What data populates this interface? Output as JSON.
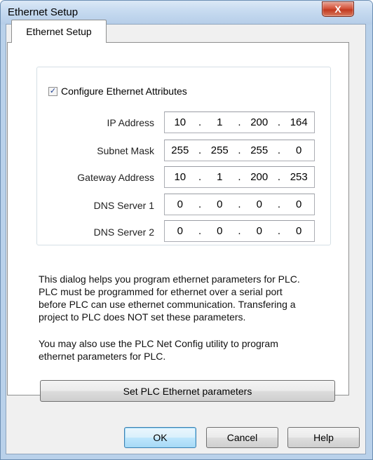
{
  "window": {
    "title": "Ethernet Setup",
    "close_glyph": "X"
  },
  "tabs": [
    {
      "label": "Ethernet Setup",
      "active": true
    }
  ],
  "group": {
    "checkbox_label": "Configure Ethernet Attributes",
    "checked": true,
    "check_glyph": "✓"
  },
  "fields": [
    {
      "label": "IP Address",
      "octets": [
        "10",
        "1",
        "200",
        "164"
      ]
    },
    {
      "label": "Subnet Mask",
      "octets": [
        "255",
        "255",
        "255",
        "0"
      ]
    },
    {
      "label": "Gateway Address",
      "octets": [
        "10",
        "1",
        "200",
        "253"
      ]
    },
    {
      "label": "DNS Server 1",
      "octets": [
        "0",
        "0",
        "0",
        "0"
      ]
    },
    {
      "label": "DNS Server 2",
      "octets": [
        "0",
        "0",
        "0",
        "0"
      ]
    }
  ],
  "ip_separator": ".",
  "description": {
    "paragraph1": [
      "This dialog helps you program ethernet parameters for PLC.",
      "PLC must be programmed for ethernet over a serial port",
      "before PLC can use ethernet communication. Transfering a",
      "project to PLC does NOT set these parameters."
    ],
    "paragraph2": [
      "You may also use the PLC Net Config utility to program",
      "ethernet parameters for PLC."
    ]
  },
  "buttons": {
    "set_params": "Set PLC Ethernet parameters",
    "ok": "OK",
    "cancel": "Cancel",
    "help": "Help"
  },
  "colors": {
    "titlebar": "#c6daf0",
    "close_button": "#c23a20",
    "dialog_face": "#f0f0f0",
    "default_button_border": "#3c7fb1"
  }
}
